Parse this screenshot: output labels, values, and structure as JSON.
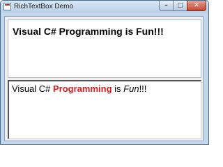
{
  "window": {
    "title": "RichTextBox Demo",
    "minimize_glyph": "–",
    "maximize_glyph": "□",
    "close_glyph": "✕"
  },
  "top_richtextbox": {
    "text": "Visual C# Programming is Fun!!!"
  },
  "bottom_richtextbox": {
    "seg1": "Visual C# ",
    "seg2": "Programming",
    "seg3": " is ",
    "seg4": "Fun",
    "seg5": "!!!"
  },
  "colors": {
    "highlight": "#e0191b"
  }
}
